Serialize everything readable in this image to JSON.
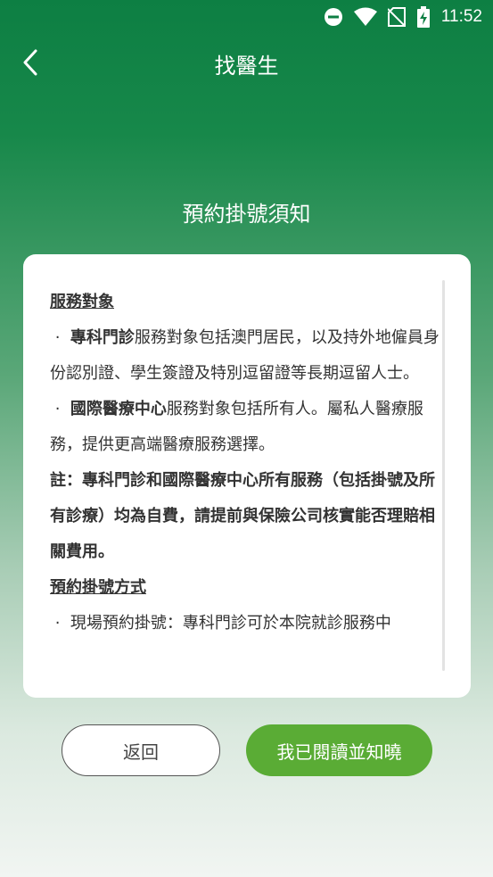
{
  "status_bar": {
    "time": "11:52",
    "icons": [
      "do-not-disturb-icon",
      "wifi-icon",
      "no-sim-icon",
      "battery-charging-icon"
    ]
  },
  "header": {
    "title": "找醫生",
    "back_icon": "chevron-left-icon"
  },
  "notice": {
    "heading": "預約掛號須知",
    "section1_title": "服務對象",
    "bullet1_bold": "專科門診",
    "bullet1_text": "服務對象包括澳門居民，以及持外地僱員身份認別證、學生簽證及特別逗留證等長期逗留人士。",
    "bullet2_bold": "國際醫療中心",
    "bullet2_text": "服務對象包括所有人。屬私人醫療服務，提供更高端醫療服務選擇。",
    "note": "註：專科門診和國際醫療中心所有服務（包括掛號及所有診療）均為自費，請提前與保險公司核實能否理賠相關費用。",
    "section2_title": "預約掛號方式",
    "bullet3_text": "現場預約掛號：專科門診可於本院就診服務中",
    "bullet_mark": "·"
  },
  "buttons": {
    "return_label": "返回",
    "confirm_label": "我已閱讀並知曉"
  },
  "colors": {
    "header_green": "#0d7f43",
    "confirm_green": "#5aac35"
  }
}
